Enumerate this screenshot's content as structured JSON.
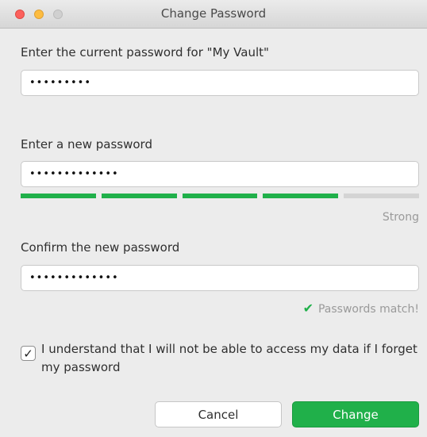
{
  "window": {
    "title": "Change Password"
  },
  "current_password": {
    "label": "Enter the current password for \"My Vault\"",
    "value": "•••••••••"
  },
  "new_password": {
    "label": "Enter a new password",
    "value": "•••••••••••••",
    "strength_label": "Strong",
    "strength_segments_filled": 4,
    "strength_segments_total": 5
  },
  "confirm_password": {
    "label": "Confirm the new password",
    "value": "•••••••••••••",
    "match_message": "Passwords match!"
  },
  "acknowledgement": {
    "checked": true,
    "text": "I understand that I will not be able to access my data if I forget my password"
  },
  "buttons": {
    "cancel": "Cancel",
    "change": "Change"
  },
  "colors": {
    "accent_green": "#20b04a",
    "strength_empty": "#d4d4d4",
    "window_bg": "#ececec"
  },
  "icons": {
    "match_icon": "checkmark-icon",
    "checkbox_icon": "checkmark-icon"
  }
}
